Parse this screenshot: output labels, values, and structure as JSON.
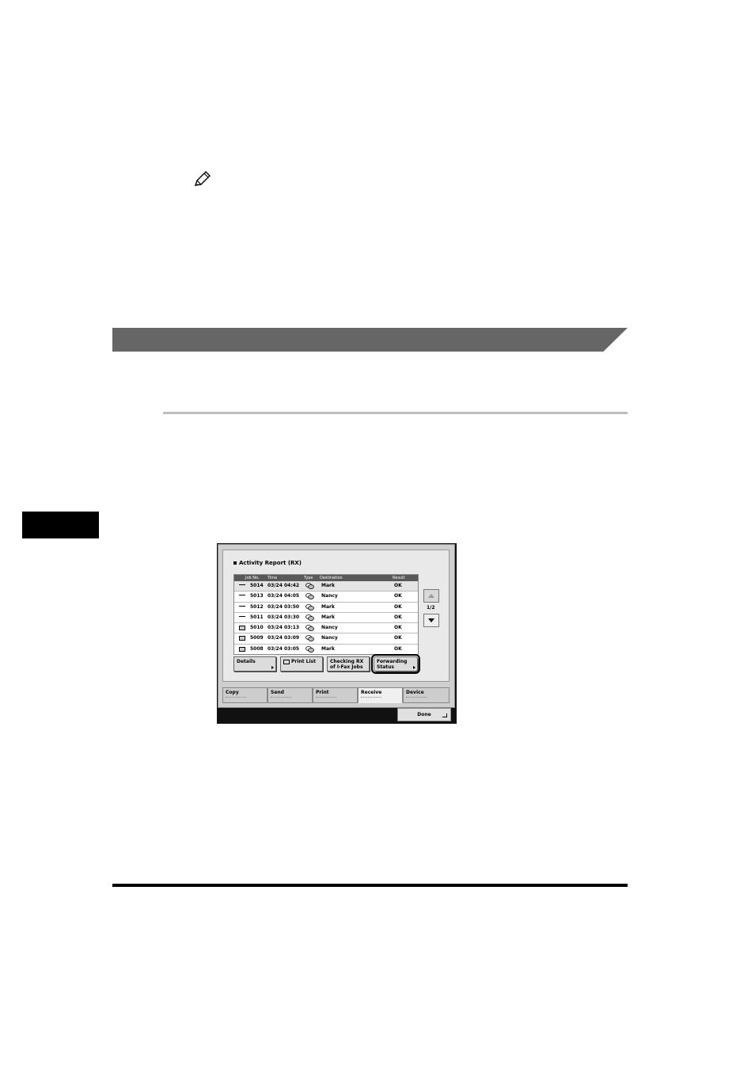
{
  "note": {
    "icon": "pencil-icon"
  },
  "screen": {
    "title": "Activity Report (RX)",
    "columns": [
      "Job No.",
      "Time",
      "Type",
      "Destination",
      "Result"
    ],
    "rows": [
      {
        "job": "5014",
        "time": "03/24 04:42",
        "dest": "Mark",
        "result": "OK"
      },
      {
        "job": "5013",
        "time": "03/24 04:05",
        "dest": "Nancy",
        "result": "OK"
      },
      {
        "job": "5012",
        "time": "03/24 03:50",
        "dest": "Mark",
        "result": "OK"
      },
      {
        "job": "5011",
        "time": "03/24 03:30",
        "dest": "Mark",
        "result": "OK"
      },
      {
        "job": "5010",
        "time": "03/24 03:13",
        "dest": "Nancy",
        "result": "OK"
      },
      {
        "job": "5009",
        "time": "03/24 03:09",
        "dest": "Nancy",
        "result": "OK"
      },
      {
        "job": "5008",
        "time": "03/24 03:05",
        "dest": "Mark",
        "result": "OK"
      }
    ],
    "page": "1/2",
    "buttons": {
      "details": "Details",
      "print_list": "Print List",
      "checking_rx_1": "Checking RX",
      "checking_rx_2": "of I-Fax Jobs",
      "forwarding_1": "Forwarding",
      "forwarding_2": "Status"
    },
    "tabs": [
      "Copy",
      "Send",
      "Print",
      "Receive",
      "Device"
    ],
    "active_tab": "Receive",
    "done": "Done"
  }
}
